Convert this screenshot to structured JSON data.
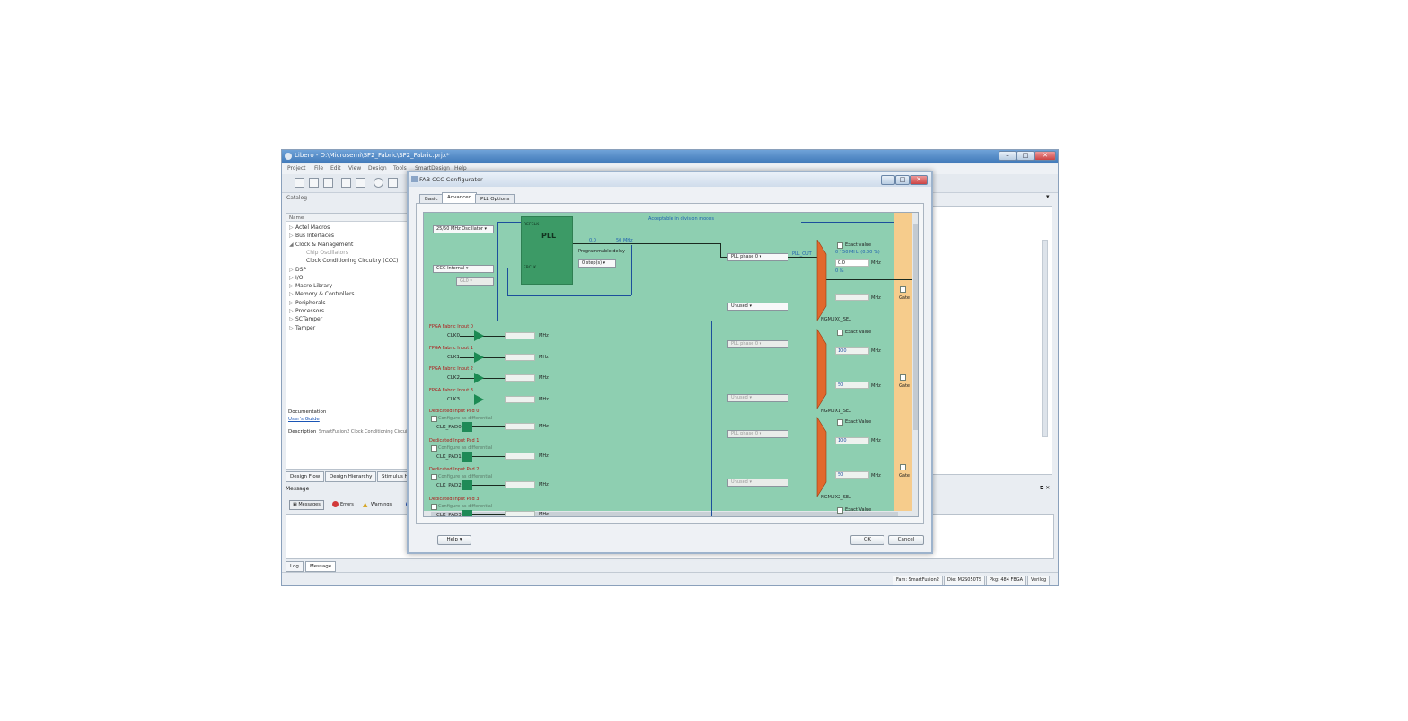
{
  "app": {
    "title": "Libero - D:\\Microsemi\\SF2_Fabric\\SF2_Fabric.prjx*",
    "menu": [
      "Project",
      "File",
      "Edit",
      "View",
      "Design",
      "Tools",
      "SmartDesign",
      "Help"
    ],
    "catalog_label": "Catalog",
    "left_pane": {
      "header": "Name",
      "tree": [
        {
          "label": "Actel Macros",
          "indent": 0
        },
        {
          "label": "Bus Interfaces",
          "indent": 0
        },
        {
          "label": "Clock & Management",
          "indent": 0
        },
        {
          "label": "Chip Oscillators",
          "indent": 1
        },
        {
          "label": "Clock Conditioning Circuitry (CCC)",
          "indent": 1
        },
        {
          "label": "DSP",
          "indent": 0
        },
        {
          "label": "I/O",
          "indent": 0
        },
        {
          "label": "Macro Library",
          "indent": 0
        },
        {
          "label": "Memory & Controllers",
          "indent": 0
        },
        {
          "label": "Peripherals",
          "indent": 0
        },
        {
          "label": "Processors",
          "indent": 0
        },
        {
          "label": "SCTamper",
          "indent": 0
        },
        {
          "label": "Tamper",
          "indent": 0
        }
      ],
      "documentation_label": "Documentation",
      "users_guide_link": "User's Guide",
      "description_label": "Description",
      "description_text": "SmartFusion2 Clock Conditioning Circuitry (CCC)"
    },
    "bottom_tabs": [
      "Design Flow",
      "Design Hierarchy",
      "Stimulus Hierarchy"
    ],
    "message_panel": {
      "title": "Message",
      "filters": [
        "Messages",
        "Errors",
        "Warnings",
        "Info"
      ],
      "tabs": [
        "Log",
        "Message"
      ]
    },
    "status_bar": [
      "Fam: SmartFusion2",
      "Die: M2S050TS",
      "Pkg: 484 FBGA",
      "Verilog"
    ]
  },
  "dialog": {
    "title": "FAB CCC Configurator",
    "tabs": [
      "Basic",
      "Advanced",
      "PLL Options"
    ],
    "active_tab": "Advanced",
    "help_button": "Help",
    "ok_button": "OK",
    "cancel_button": "Cancel",
    "diagram": {
      "osc_select": "25/50 MHz Oscillator",
      "ccc_select": "CCC Internal",
      "ccc_sub_select": "GL0",
      "pll_label": "PLL",
      "pll_ref_label": "REFCLK",
      "pll_fb_label": "FBCLK",
      "top_annotation": "Acceptable in division modes",
      "freq_a": "0.0",
      "freq_b": "50 MHz",
      "prog_delay_label": "Programmable delay",
      "prog_delay_value": "0 step(s)",
      "pll_phase_0": "PLL phase 0",
      "out0_note": "PLL_OUT",
      "out0_exact_label": "Exact value",
      "out0_exact_text": "0 / 50 MHz (0.00 %)",
      "out0_freq_value": "0.0",
      "out0_unit": "MHz",
      "out0_unit_b": "MHz",
      "out0_frac": "0 %",
      "unused_1": "Unused",
      "mux0_label": "NGMUX0_SEL",
      "gate_label": "Gate",
      "exact_value_1": "Exact Value",
      "pll_phase_out2": "PLL phase 0",
      "out1_value_a": "100",
      "out1_value_b": "50",
      "unused_2": "Unused",
      "mux1_label": "NGMUX1_SEL",
      "exact_value_2": "Exact Value",
      "pll_phase_out3": "PLL phase 0",
      "out2_value_a": "100",
      "out2_value_b": "50",
      "unused_3": "Unused",
      "mux2_label": "NGMUX2_SEL",
      "exact_value_3": "Exact Value",
      "fabric_inputs": [
        {
          "title": "FPGA Fabric Input 0",
          "clk": "CLK0",
          "unit": "MHz"
        },
        {
          "title": "FPGA Fabric Input 1",
          "clk": "CLK1",
          "unit": "MHz"
        },
        {
          "title": "FPGA Fabric Input 2",
          "clk": "CLK2",
          "unit": "MHz"
        },
        {
          "title": "FPGA Fabric Input 3",
          "clk": "CLK3",
          "unit": "MHz"
        }
      ],
      "dedicated_inputs": [
        {
          "title": "Dedicated Input Pad 0",
          "option": "Configure as differential",
          "pad": "CLK_PAD0",
          "unit": "MHz"
        },
        {
          "title": "Dedicated Input Pad 1",
          "option": "Configure as differential",
          "pad": "CLK_PAD1",
          "unit": "MHz"
        },
        {
          "title": "Dedicated Input Pad 2",
          "option": "Configure as differential",
          "pad": "CLK_PAD2",
          "unit": "MHz"
        },
        {
          "title": "Dedicated Input Pad 3",
          "option": "Configure as differential",
          "pad": "CLK_PAD3",
          "unit": "MHz"
        }
      ]
    }
  }
}
